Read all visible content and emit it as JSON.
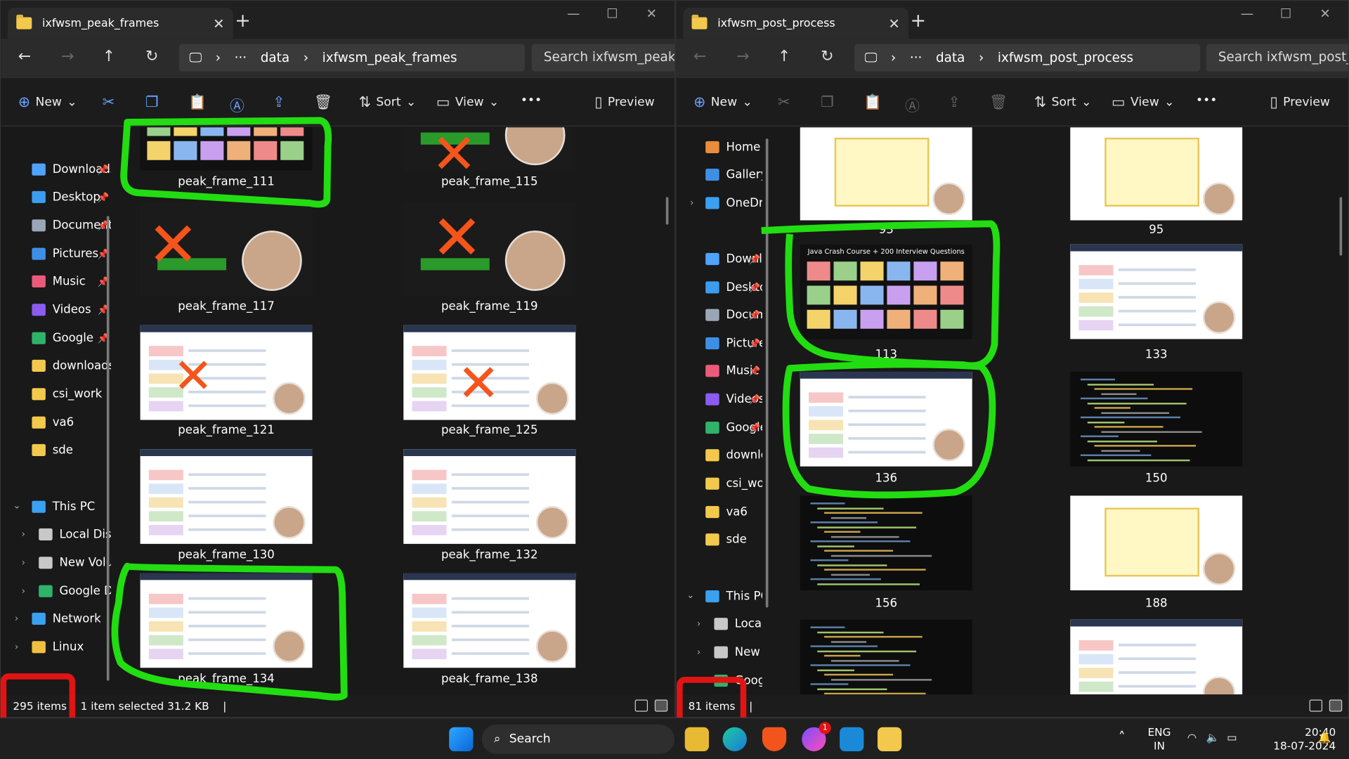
{
  "left_window": {
    "tab_title": "ixfwsm_peak_frames",
    "breadcrumb": [
      "data",
      "ixfwsm_peak_frames"
    ],
    "search_placeholder": "Search ixfwsm_peak_frames",
    "toolbar": {
      "new": "New",
      "sort": "Sort",
      "view": "View",
      "preview": "Preview"
    },
    "sidebar": [
      {
        "label": "Downloads",
        "icon": "download-icon",
        "pinned": true
      },
      {
        "label": "Desktop",
        "icon": "desktop-icon",
        "pinned": true
      },
      {
        "label": "Documents",
        "icon": "document-icon",
        "pinned": true
      },
      {
        "label": "Pictures",
        "icon": "pictures-icon",
        "pinned": true
      },
      {
        "label": "Music",
        "icon": "music-icon",
        "pinned": true
      },
      {
        "label": "Videos",
        "icon": "videos-icon",
        "pinned": true
      },
      {
        "label": "Google",
        "icon": "google-drive-icon",
        "pinned": true
      },
      {
        "label": "downloads",
        "icon": "folder-icon",
        "pinned": false
      },
      {
        "label": "csi_work",
        "icon": "folder-icon",
        "pinned": false
      },
      {
        "label": "va6",
        "icon": "folder-icon",
        "pinned": false
      },
      {
        "label": "sde",
        "icon": "folder-icon",
        "pinned": false
      },
      {
        "label": "This PC",
        "icon": "pc-icon",
        "pinned": false
      },
      {
        "label": "Local Disk",
        "icon": "disk-icon",
        "pinned": false
      },
      {
        "label": "New Volume",
        "icon": "disk-icon",
        "pinned": false
      },
      {
        "label": "Google Drive",
        "icon": "google-drive-icon",
        "pinned": false
      },
      {
        "label": "Network",
        "icon": "network-icon",
        "pinned": false
      },
      {
        "label": "Linux",
        "icon": "linux-icon",
        "pinned": false
      }
    ],
    "files": [
      "peak_frame_111",
      "peak_frame_115",
      "peak_frame_117",
      "peak_frame_119",
      "peak_frame_121",
      "peak_frame_125",
      "peak_frame_130",
      "peak_frame_132",
      "peak_frame_134",
      "peak_frame_138"
    ],
    "status": {
      "count": "295 items",
      "selection": "1 item selected  31.2 KB"
    }
  },
  "right_window": {
    "tab_title": "ixfwsm_post_process",
    "breadcrumb": [
      "data",
      "ixfwsm_post_process"
    ],
    "search_placeholder": "Search ixfwsm_post_process",
    "toolbar": {
      "new": "New",
      "sort": "Sort",
      "view": "View",
      "preview": "Preview"
    },
    "sidebar": [
      {
        "label": "Home",
        "icon": "home-icon",
        "pinned": false
      },
      {
        "label": "Gallery",
        "icon": "gallery-icon",
        "pinned": false
      },
      {
        "label": "OneDrive",
        "icon": "onedrive-icon",
        "pinned": false
      },
      {
        "label": "Downloads",
        "icon": "download-icon",
        "pinned": true
      },
      {
        "label": "Desktop",
        "icon": "desktop-icon",
        "pinned": true
      },
      {
        "label": "Documents",
        "icon": "document-icon",
        "pinned": true
      },
      {
        "label": "Pictures",
        "icon": "pictures-icon",
        "pinned": true
      },
      {
        "label": "Music",
        "icon": "music-icon",
        "pinned": true
      },
      {
        "label": "Videos",
        "icon": "videos-icon",
        "pinned": true
      },
      {
        "label": "Google",
        "icon": "google-drive-icon",
        "pinned": true
      },
      {
        "label": "downloads",
        "icon": "folder-icon",
        "pinned": false
      },
      {
        "label": "csi_work",
        "icon": "folder-icon",
        "pinned": false
      },
      {
        "label": "va6",
        "icon": "folder-icon",
        "pinned": false
      },
      {
        "label": "sde",
        "icon": "folder-icon",
        "pinned": false
      },
      {
        "label": "This PC",
        "icon": "pc-icon",
        "pinned": false
      },
      {
        "label": "Local Disk",
        "icon": "disk-icon",
        "pinned": false
      },
      {
        "label": "New Volume",
        "icon": "disk-icon",
        "pinned": false
      },
      {
        "label": "Google Drive",
        "icon": "google-drive-icon",
        "pinned": false
      }
    ],
    "files": [
      "93",
      "95",
      "113",
      "133",
      "136",
      "150",
      "156",
      "188",
      "",
      ""
    ],
    "thumb_title_113": "Java Crash Course + 200 Interview Questions",
    "status": {
      "count": "81 items"
    }
  },
  "taskbar": {
    "search": "Search",
    "apps": [
      "windows-start-icon",
      "file-explorer-icon",
      "edge-icon",
      "brave-icon",
      "messenger-icon",
      "vscode-icon",
      "folder-icon"
    ],
    "notification_badge": "1",
    "language": "ENG",
    "region": "IN",
    "time": "20:40",
    "date": "18-07-2024"
  },
  "annotations": {
    "highlight_color": "#22dd11",
    "cross_color": "#f5541b",
    "status_box_color": "#e01414"
  }
}
